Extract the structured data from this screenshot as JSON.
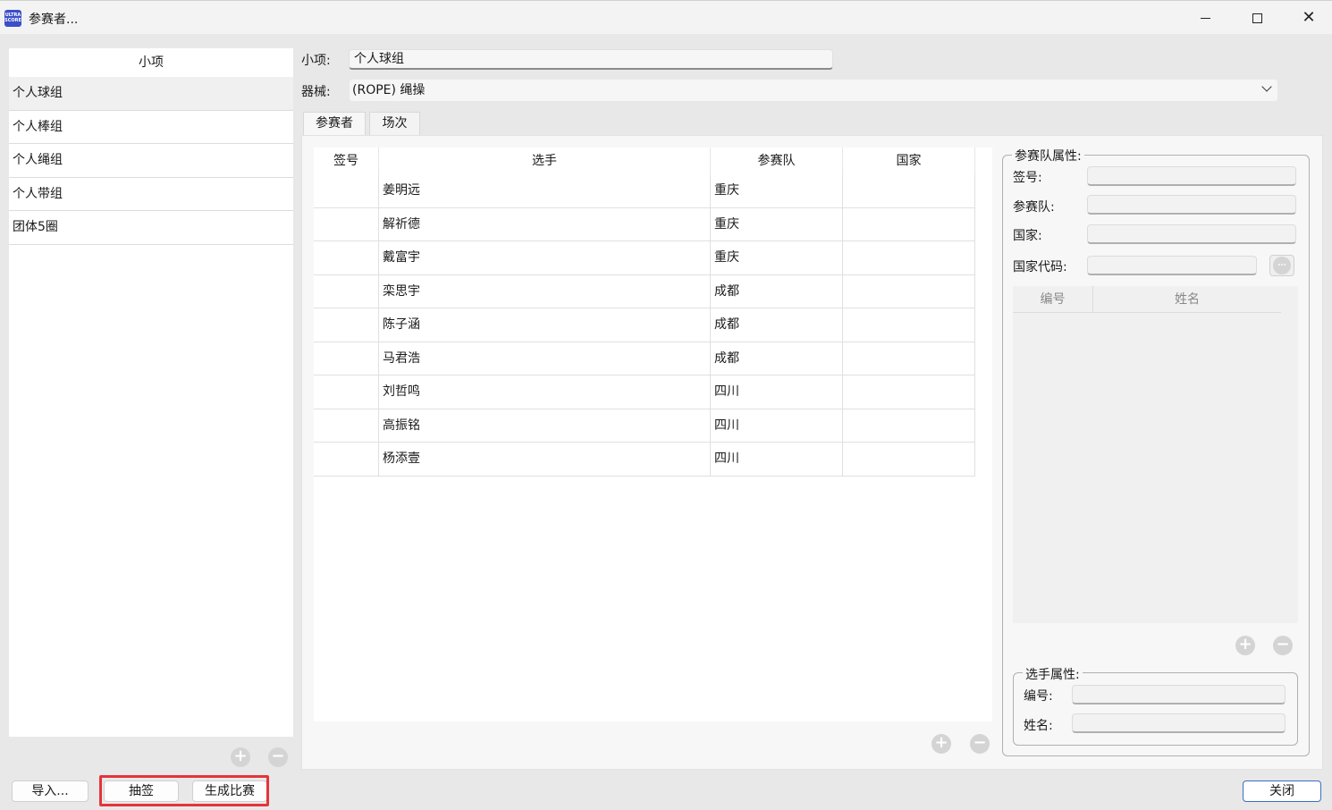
{
  "window": {
    "title": "参赛者...",
    "icon_text": "ULTRA SCORE",
    "minimize_label": "—",
    "close_label": "✕"
  },
  "events_list": {
    "header": "小项",
    "items": [
      "个人球组",
      "个人棒组",
      "个人绳组",
      "个人带组",
      "团体5圈"
    ],
    "selected_index": 0
  },
  "form": {
    "event_label": "小项:",
    "event_value": "个人球组",
    "apparatus_label": "器械:",
    "apparatus_value": "(ROPE) 绳操"
  },
  "tabs": [
    {
      "label": "参赛者",
      "active": true
    },
    {
      "label": "场次",
      "active": false
    }
  ],
  "participants_table": {
    "columns": [
      "签号",
      "选手",
      "参赛队",
      "国家"
    ],
    "rows": [
      [
        "",
        "姜明远",
        "重庆",
        ""
      ],
      [
        "",
        "解祈德",
        "重庆",
        ""
      ],
      [
        "",
        "戴富宇",
        "重庆",
        ""
      ],
      [
        "",
        "栾思宇",
        "成都",
        ""
      ],
      [
        "",
        "陈子涵",
        "成都",
        ""
      ],
      [
        "",
        "马君浩",
        "成都",
        ""
      ],
      [
        "",
        "刘哲鸣",
        "四川",
        ""
      ],
      [
        "",
        "高振铭",
        "四川",
        ""
      ],
      [
        "",
        "杨添壹",
        "四川",
        ""
      ]
    ]
  },
  "team_properties": {
    "title": "参赛队属性:",
    "draw_number_label": "签号:",
    "team_label": "参赛队:",
    "country_label": "国家:",
    "country_code_label": "国家代码:",
    "members_columns": [
      "编号",
      "姓名"
    ]
  },
  "athlete_properties": {
    "title": "选手属性:",
    "number_label": "编号:",
    "name_label": "姓名:"
  },
  "buttons": {
    "import": "导入...",
    "draw": "抽签",
    "generate": "生成比赛",
    "close": "关闭"
  }
}
